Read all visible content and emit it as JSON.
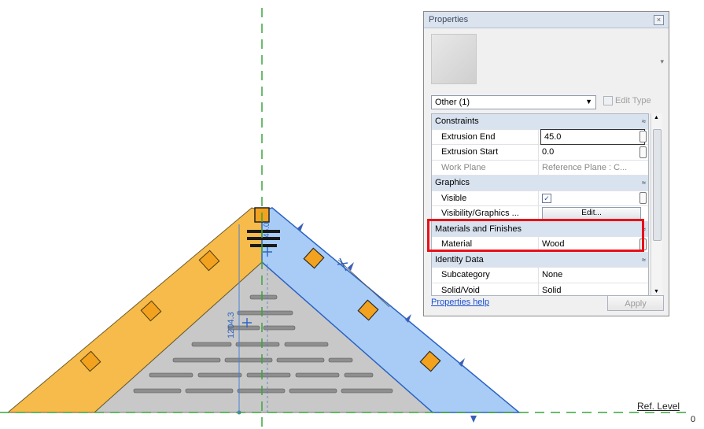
{
  "view": {
    "dimensions": [
      "1204.3",
      "45.0"
    ],
    "ref_level": {
      "name": "Ref. Level",
      "value": "0"
    }
  },
  "properties": {
    "title": "Properties",
    "selector": "Other (1)",
    "edit_type": "Edit Type",
    "groups": [
      {
        "name": "Constraints",
        "rows": [
          {
            "name": "Extrusion End",
            "value": "45.0",
            "boxed": true
          },
          {
            "name": "Extrusion Start",
            "value": "0.0"
          },
          {
            "name": "Work Plane",
            "value": "Reference Plane : C...",
            "dim": true
          }
        ]
      },
      {
        "name": "Graphics",
        "rows": [
          {
            "name": "Visible",
            "value": "✓",
            "checkbox": true
          },
          {
            "name": "Visibility/Graphics ...",
            "value": "Edit...",
            "button": true
          }
        ]
      },
      {
        "name": "Materials and Finishes",
        "rows": [
          {
            "name": "Material",
            "value": "Wood"
          }
        ]
      },
      {
        "name": "Identity Data",
        "rows": [
          {
            "name": "Subcategory",
            "value": "None"
          },
          {
            "name": "Solid/Void",
            "value": "Solid"
          }
        ]
      }
    ],
    "help": "Properties help",
    "apply": "Apply"
  },
  "colors": {
    "orange": "#f6bb4a",
    "blue": "#a8ccf6",
    "gray": "#c8c8c8",
    "highlight": "#e8101a",
    "guide": "#3aa53a"
  }
}
